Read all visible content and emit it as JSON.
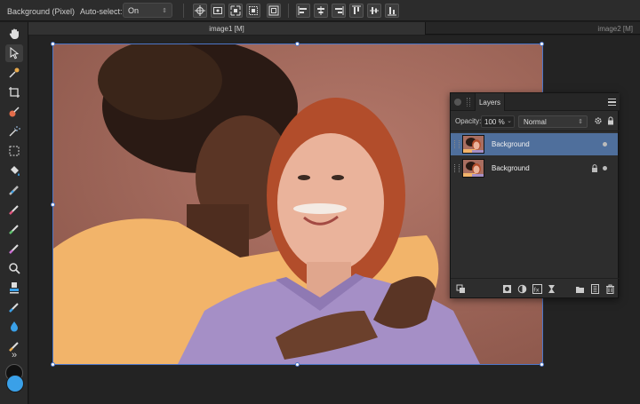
{
  "context_toolbar": {
    "layer_type": "Background (Pixel)",
    "autoselect_label": "Auto-select:",
    "autoselect_value": "On",
    "buttons": [
      "transform-origin",
      "show-bounding-box",
      "snap-objects",
      "show-alignment-handles",
      "transform-objects-separately",
      "align-left",
      "align-center",
      "align-right",
      "align-top",
      "align-middle",
      "align-bottom"
    ]
  },
  "tabs": {
    "active": "image1 [M]",
    "inactive": "image2 [M]"
  },
  "tools": [
    "hand-icon",
    "move-icon",
    "color-picker-icon",
    "crop-icon",
    "paint-brush-icon",
    "flood-select-icon",
    "marquee-select-icon",
    "flood-fill-icon",
    "healing-brush-icon",
    "paintbrush-icon",
    "erase-brush-icon",
    "smudge-brush-icon",
    "zoom-icon",
    "clone-brush-icon",
    "dodge-brush-icon",
    "blur-brush-icon",
    "sponge-brush-icon"
  ],
  "colors": {
    "primary": "#3aa0e8",
    "secondary": "#111111",
    "selection": "#4d76c8",
    "layer_selected": "#4f6f9c"
  },
  "layers_panel": {
    "tab": "Layers",
    "opacity_label": "Opacity:",
    "opacity_value": "100 %",
    "blend_mode": "Normal",
    "layers": [
      {
        "name": "Background",
        "selected": true,
        "locked": false,
        "visible": true
      },
      {
        "name": "Background",
        "selected": false,
        "locked": true,
        "visible": true
      }
    ],
    "footer_icons": [
      "layer-mask-icon",
      "adjustments-icon",
      "fx-icon",
      "live-filters-icon",
      "group-icon",
      "new-layer-icon",
      "delete-icon"
    ]
  }
}
